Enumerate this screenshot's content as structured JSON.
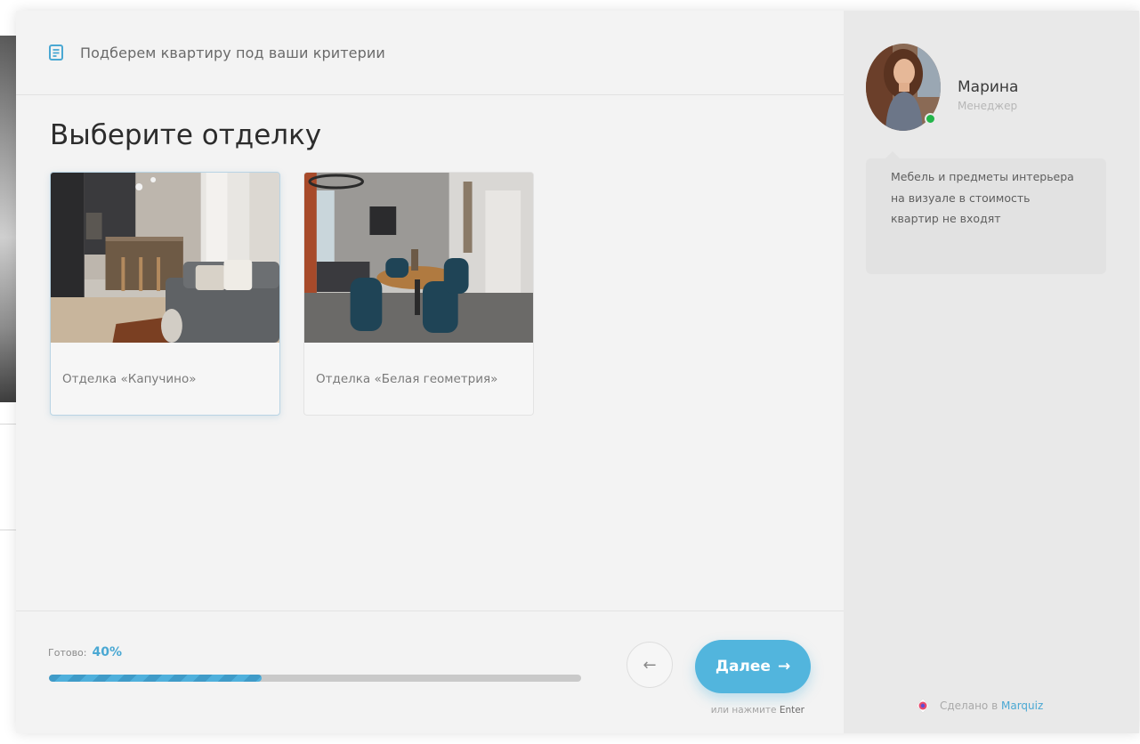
{
  "header": {
    "text": "Подберем квартиру под ваши критерии",
    "icon": "form-list-icon"
  },
  "question": {
    "title": "Выберите отделку"
  },
  "options": [
    {
      "label": "Отделка «Капучино»",
      "selected": true
    },
    {
      "label": "Отделка «Белая геометрия»",
      "selected": false
    }
  ],
  "progress": {
    "label": "Готово:",
    "value": "40%",
    "fraction": 0.4
  },
  "buttons": {
    "back_icon": "←",
    "next_label": "Далее",
    "next_icon": "→"
  },
  "hint": {
    "prefix": "или нажмите",
    "key": "Enter"
  },
  "manager": {
    "name": "Марина",
    "role": "Менеджер",
    "status": "online",
    "message": "Мебель и предметы интерьера на визуале в стоимость квартир не входят"
  },
  "footer": {
    "made_with": "Сделано в",
    "brand": "Marquiz"
  },
  "colors": {
    "accent": "#52b5dd",
    "online": "#23b54a",
    "panel_bg": "#e9e9e9",
    "main_bg": "#f3f3f3"
  }
}
